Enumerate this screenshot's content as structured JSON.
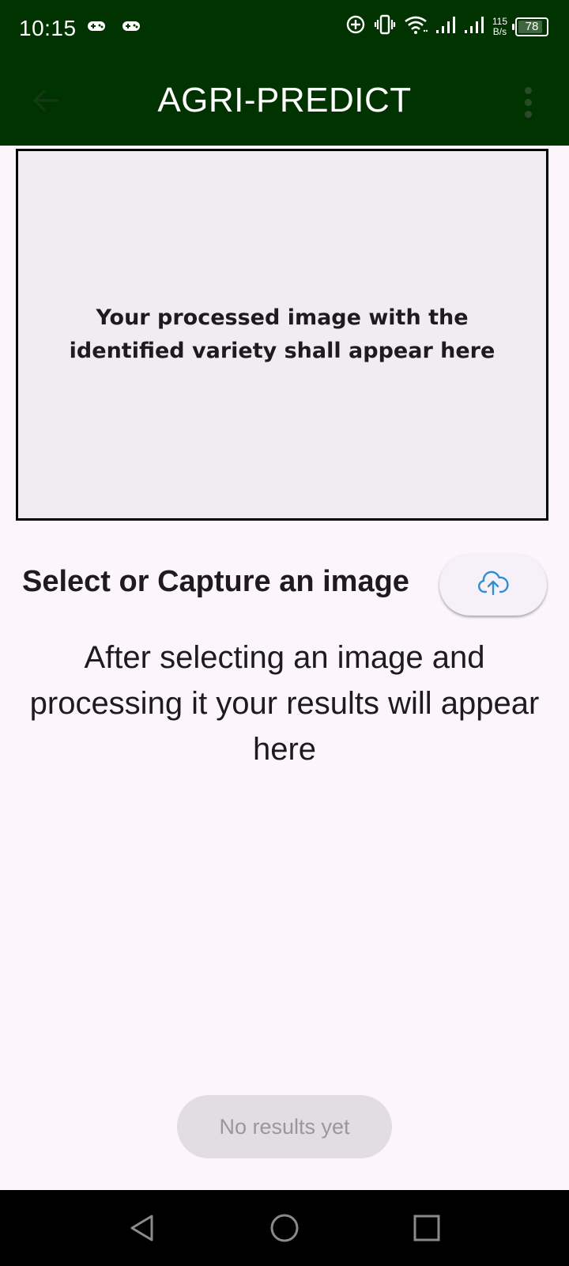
{
  "status_bar": {
    "time": "10:15",
    "net_speed_value": "115",
    "net_speed_unit": "B/s",
    "battery": "78",
    "left_icons": [
      "gamepad-icon",
      "gamepad-icon"
    ],
    "right_icons": [
      "data-saver-icon",
      "vibrate-icon",
      "wifi-icon",
      "signal-icon",
      "signal-icon"
    ]
  },
  "app_bar": {
    "title": "AGRI-PREDICT",
    "back_icon": "arrow-left-icon",
    "menu_icon": "more-vert-icon",
    "background": "#003300"
  },
  "preview": {
    "placeholder": "Your processed image with the identified variety shall appear here"
  },
  "select": {
    "label": "Select or Capture an image",
    "upload_icon": "cloud-upload-icon",
    "icon_color": "#2f8fd0"
  },
  "results": {
    "message": "After selecting an image and processing it your results will appear here",
    "button_label": "No results yet"
  },
  "nav_bar": {
    "icons": [
      "nav-back-icon",
      "nav-home-icon",
      "nav-recents-icon"
    ]
  }
}
